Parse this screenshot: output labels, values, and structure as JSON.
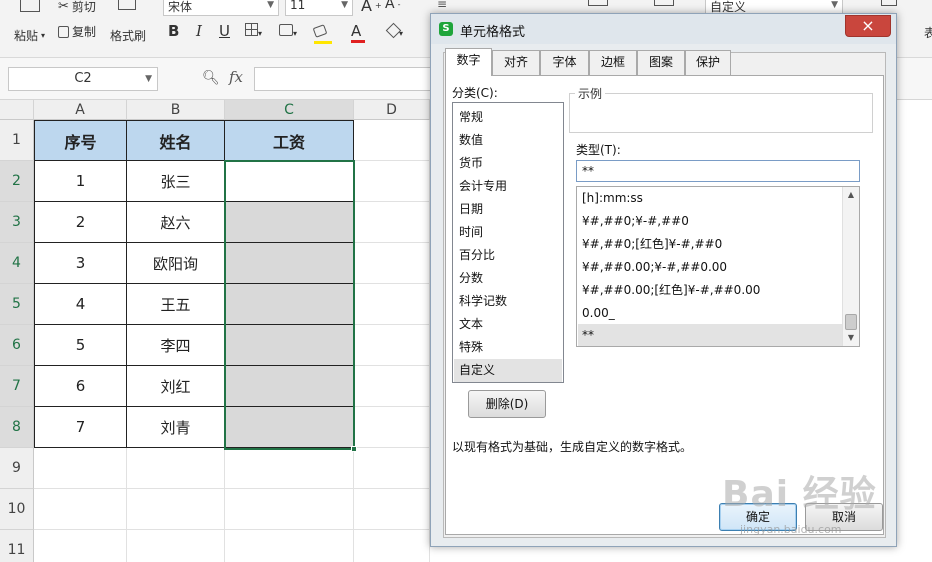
{
  "ribbon": {
    "paste": "粘贴",
    "cut": "剪切",
    "copy": "复制",
    "format_painter": "格式刷",
    "font_name": "宋体",
    "font_size": "11",
    "bold": "B",
    "italic": "I",
    "underline": "U",
    "font_color": "A",
    "grow_font": "A",
    "shrink_font": "A",
    "number_format": "自定义"
  },
  "formula_bar": {
    "name_box": "C2",
    "fx": "fx",
    "formula": ""
  },
  "grid": {
    "columns": [
      "A",
      "B",
      "C",
      "D"
    ],
    "rows": [
      "1",
      "2",
      "3",
      "4",
      "5",
      "6",
      "7",
      "8",
      "9",
      "10",
      "11"
    ],
    "header": [
      "序号",
      "姓名",
      "工资"
    ],
    "data": [
      [
        "1",
        "张三",
        ""
      ],
      [
        "2",
        "赵六",
        ""
      ],
      [
        "3",
        "欧阳询",
        ""
      ],
      [
        "4",
        "王五",
        ""
      ],
      [
        "5",
        "李四",
        ""
      ],
      [
        "6",
        "刘红",
        ""
      ],
      [
        "7",
        "刘青",
        ""
      ]
    ],
    "selected_cell": "C2"
  },
  "dialog": {
    "title": "单元格格式",
    "close": "×",
    "tabs": [
      "数字",
      "对齐",
      "字体",
      "边框",
      "图案",
      "保护"
    ],
    "active_tab": "数字",
    "category_label": "分类(C):",
    "categories": [
      "常规",
      "数值",
      "货币",
      "会计专用",
      "日期",
      "时间",
      "百分比",
      "分数",
      "科学记数",
      "文本",
      "特殊",
      "自定义"
    ],
    "selected_category": "自定义",
    "sample_label": "示例",
    "type_label": "类型(T):",
    "type_value": "**",
    "types": [
      "[h]:mm:ss",
      "¥#,##0;¥-#,##0",
      "¥#,##0;[红色]¥-#,##0",
      "¥#,##0.00;¥-#,##0.00",
      "¥#,##0.00;[红色]¥-#,##0.00",
      "0.00_",
      "**"
    ],
    "selected_type": "**",
    "delete_button": "删除(D)",
    "description": "以现有格式为基础，生成自定义的数字格式。",
    "ok_button": "确定",
    "cancel_button": "取消"
  },
  "watermark": {
    "text": "Bai 经验",
    "sub": "jingyan.baidu.com"
  },
  "colors": {
    "header_fill": "#bdd7ee",
    "gray_fill": "#d9d9d9",
    "selection": "#217346",
    "close_button": "#c9463d"
  }
}
